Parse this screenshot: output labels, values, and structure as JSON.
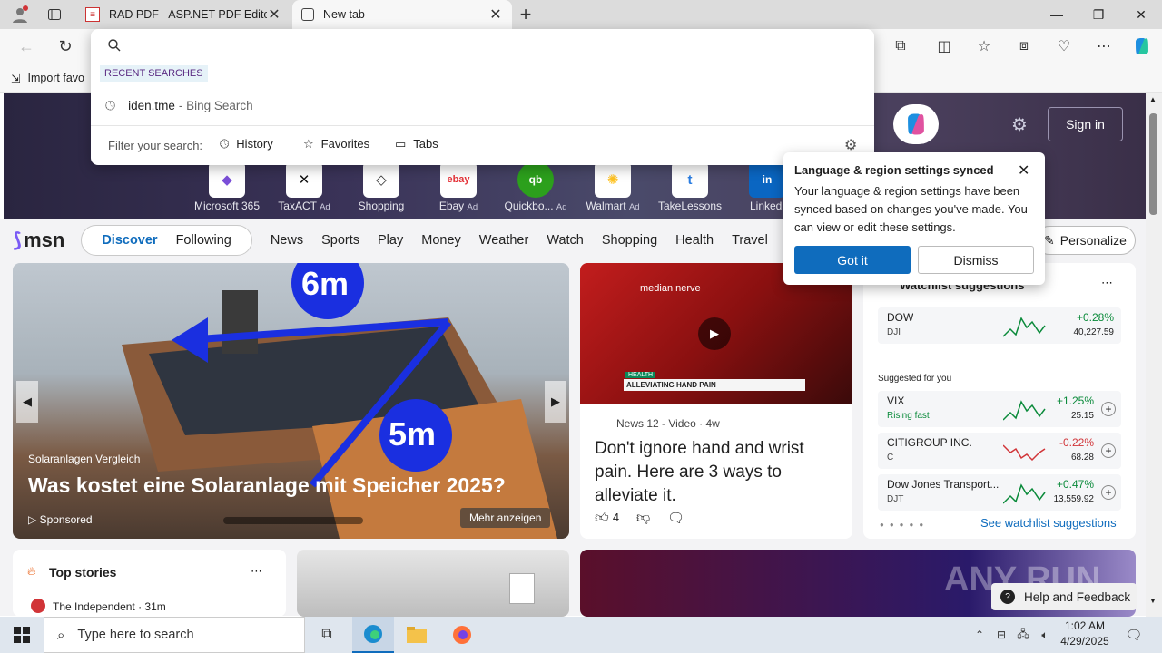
{
  "tabs": [
    {
      "title": "RAD PDF - ASP.NET PDF Editor ar"
    },
    {
      "title": "New tab"
    }
  ],
  "new_tab_symbol": "+",
  "window_controls": {
    "minimize": "—",
    "restore": "❐",
    "close": "✕"
  },
  "favorites_bar": {
    "import_label": "Import favo"
  },
  "omnibox": {
    "value": "",
    "recent_header": "RECENT SEARCHES",
    "recent_items": [
      {
        "query": "iden.tme",
        "source": "- Bing Search"
      }
    ],
    "filter_label": "Filter your search:",
    "filters": [
      "History",
      "Favorites",
      "Tabs"
    ]
  },
  "quick_links": [
    {
      "label": "Microsoft 365",
      "ad": ""
    },
    {
      "label": "TaxACT",
      "ad": "Ad"
    },
    {
      "label": "Shopping",
      "ad": ""
    },
    {
      "label": "Ebay",
      "ad": "Ad"
    },
    {
      "label": "Quickbo...",
      "ad": "Ad"
    },
    {
      "label": "Walmart",
      "ad": "Ad"
    },
    {
      "label": "TakeLessons",
      "ad": ""
    },
    {
      "label": "Linkedl",
      "ad": ""
    }
  ],
  "header": {
    "sign_in": "Sign in"
  },
  "msn": {
    "logo": "msn",
    "tabs": [
      "Discover",
      "Following"
    ],
    "nav": [
      "News",
      "Sports",
      "Play",
      "Money",
      "Weather",
      "Watch",
      "Shopping",
      "Health",
      "Travel",
      "T"
    ],
    "personalize": "Personalize"
  },
  "hero_story": {
    "source": "Solaranlagen Vergleich",
    "title": "Was kostet eine Solaranlage mit Speicher 2025?",
    "sponsored": "Sponsored",
    "more": "Mehr anzeigen",
    "label_6m": "6m",
    "label_5m": "5m"
  },
  "video_story": {
    "overlay1": "median nerve",
    "overlay2": "HEALTH",
    "overlay3": "ALLEVIATING HAND PAIN",
    "source": "News 12 - Video · 4w",
    "title": "Don't ignore hand and wrist pain. Here are 3 ways to alleviate it.",
    "likes": "4"
  },
  "sync_popup": {
    "title": "Language & region settings synced",
    "body": "Your language & region settings have been synced based on changes you've made. You can view or edit these settings.",
    "got_it": "Got it",
    "dismiss": "Dismiss"
  },
  "watchlist": {
    "title": "Watchlist suggestions",
    "suggested_header": "Suggested for you",
    "see_more": "See watchlist suggestions",
    "colors": {
      "up": "#0a8a3a",
      "down": "#d13438"
    },
    "stocks": [
      {
        "name": "DOW",
        "ticker": "DJI",
        "change": "+0.28%",
        "price": "40,227.59",
        "dir": "up"
      },
      {
        "name": "VIX",
        "ticker": "Rising fast",
        "change": "+1.25%",
        "price": "25.15",
        "dir": "up"
      },
      {
        "name": "CITIGROUP INC.",
        "ticker": "C",
        "change": "-0.22%",
        "price": "68.28",
        "dir": "down"
      },
      {
        "name": "Dow Jones Transport...",
        "ticker": "DJT",
        "change": "+0.47%",
        "price": "13,559.92",
        "dir": "up"
      }
    ]
  },
  "top_stories": {
    "title": "Top stories",
    "item": "The Independent · 31m"
  },
  "help": "Help and Feedback",
  "taskbar": {
    "search_placeholder": "Type here to search",
    "time": "1:02 AM",
    "date": "4/29/2025"
  },
  "watermark": "ANY RUN"
}
